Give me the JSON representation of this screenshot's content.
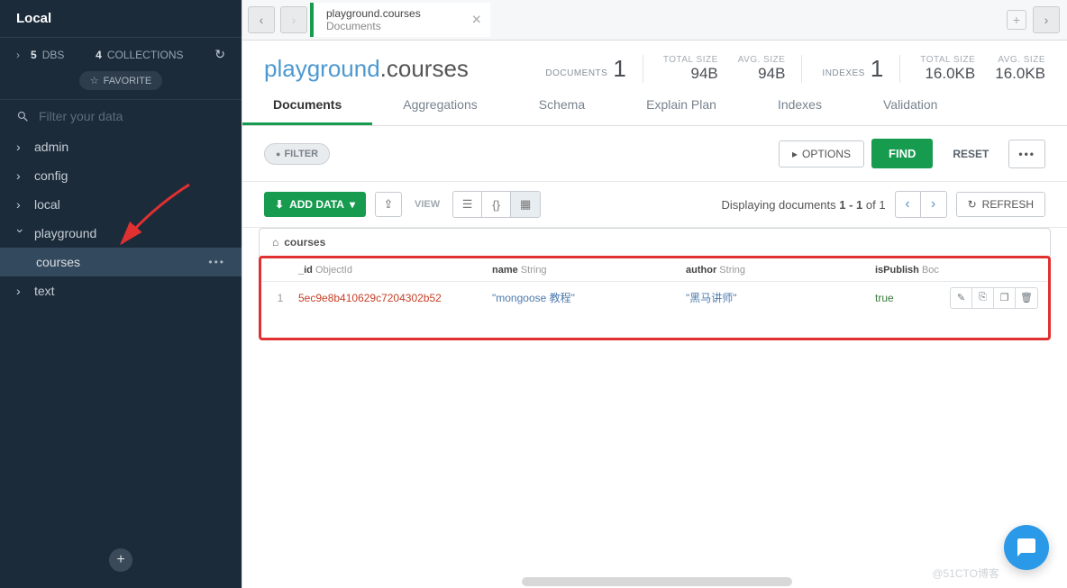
{
  "sidebar": {
    "connection": "Local",
    "dbs_count": "5",
    "dbs_label": "DBS",
    "colls_count": "4",
    "colls_label": "COLLECTIONS",
    "favorite": "FAVORITE",
    "search_placeholder": "Filter your data",
    "databases": [
      {
        "name": "admin",
        "expanded": false
      },
      {
        "name": "config",
        "expanded": false
      },
      {
        "name": "local",
        "expanded": false
      },
      {
        "name": "playground",
        "expanded": true,
        "collections": [
          {
            "name": "courses",
            "active": true
          }
        ]
      },
      {
        "name": "text",
        "expanded": false
      }
    ]
  },
  "tab": {
    "title": "playground.courses",
    "subtitle": "Documents"
  },
  "namespace": {
    "db": "playground",
    "collection": ".courses"
  },
  "stats": {
    "documents_label": "DOCUMENTS",
    "documents": "1",
    "total_size_label": "TOTAL SIZE",
    "total_size": "94B",
    "avg_size_label": "AVG. SIZE",
    "avg_size": "94B",
    "indexes_label": "INDEXES",
    "indexes": "1",
    "idx_total_size": "16.0KB",
    "idx_avg_size": "16.0KB"
  },
  "subtabs": [
    "Documents",
    "Aggregations",
    "Schema",
    "Explain Plan",
    "Indexes",
    "Validation"
  ],
  "filter": {
    "label": "FILTER",
    "options": "OPTIONS",
    "find": "FIND",
    "reset": "RESET"
  },
  "toolbar": {
    "add_data": "ADD DATA",
    "view": "VIEW",
    "display": "Displaying documents ",
    "range": "1 - 1",
    "of": " of ",
    "total": "1",
    "refresh": "REFRESH"
  },
  "crumb": "courses",
  "columns": [
    {
      "field": "_id",
      "type": "ObjectId"
    },
    {
      "field": "name",
      "type": "String"
    },
    {
      "field": "author",
      "type": "String"
    },
    {
      "field": "isPublish",
      "type": "Boc"
    }
  ],
  "rows": [
    {
      "n": "1",
      "_id": "5ec9e8b410629c7204302b52",
      "name": "\"mongoose 教程\"",
      "author": "\"黑马讲师\"",
      "isPublish": "true"
    }
  ],
  "watermark": "@51CTO博客"
}
